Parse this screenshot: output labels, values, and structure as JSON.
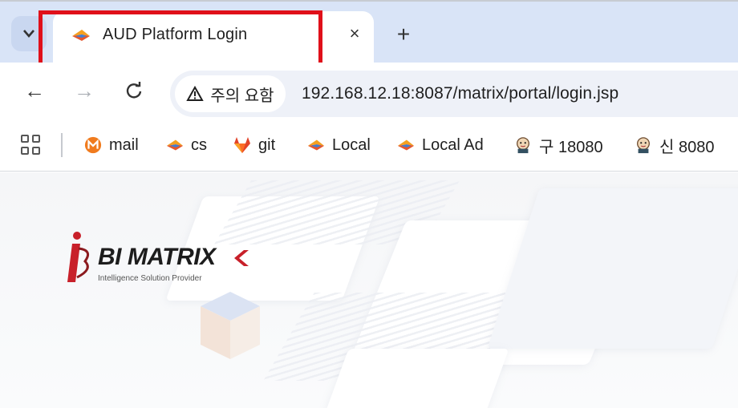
{
  "browser": {
    "tab_menu_icon": "chevron-down-icon",
    "active_tab": {
      "title": "AUD Platform Login",
      "favicon": "aud-logo-icon"
    },
    "tab_close_label": "×",
    "new_tab_label": "+",
    "highlight_color": "#e0101a"
  },
  "toolbar": {
    "back_label": "←",
    "forward_label": "→",
    "reload_label": "C",
    "security_chip": {
      "icon": "warning-triangle-icon",
      "label": "주의 요함"
    },
    "url": "192.168.12.18:8087/matrix/portal/login.jsp"
  },
  "bookmarks": [
    {
      "label": "mail",
      "icon": "mail-m-icon"
    },
    {
      "label": "cs",
      "icon": "aud-logo-icon"
    },
    {
      "label": "git",
      "icon": "gitlab-fox-icon"
    },
    {
      "label": "Local",
      "icon": "aud-logo-icon"
    },
    {
      "label": "Local Ad",
      "icon": "aud-logo-icon"
    },
    {
      "label": "구 18080",
      "icon": "jenkins-icon"
    },
    {
      "label": "신 8080",
      "icon": "jenkins-icon"
    }
  ],
  "page": {
    "logo_text": "BI MATRIX",
    "logo_tagline": "Intelligence Solution Provider"
  }
}
